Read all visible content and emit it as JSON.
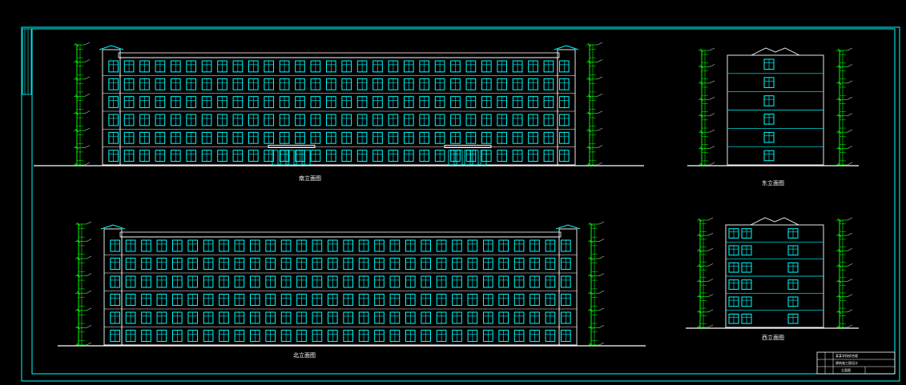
{
  "colors": {
    "background": "#000000",
    "frame": "#00ffff",
    "window": "#00ffff",
    "wall": "#ffffff",
    "dimension": "#00ff00",
    "ground": "#ffffff"
  },
  "elevations": [
    {
      "id": "south",
      "title": "南立面图"
    },
    {
      "id": "north",
      "title": "北立面图"
    },
    {
      "id": "east",
      "title": "东立面图"
    },
    {
      "id": "west",
      "title": "西立面图"
    }
  ],
  "title_block": {
    "line1": "某某学校综合楼",
    "line2": "建筑施工图设计",
    "drawing_name": "立面图"
  }
}
